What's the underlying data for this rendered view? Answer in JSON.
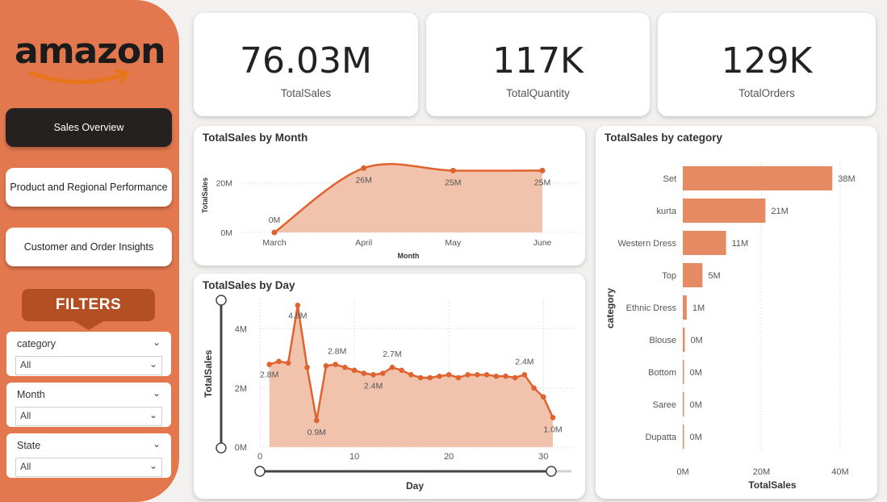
{
  "app": {
    "logo_text": "amazon"
  },
  "nav": [
    {
      "label": "Sales Overview",
      "active": true
    },
    {
      "label": "Product and Regional Performance",
      "active": false
    },
    {
      "label": "Customer and Order Insights",
      "active": false
    }
  ],
  "filters": {
    "title": "FILTERS",
    "items": [
      {
        "label": "category",
        "value": "All"
      },
      {
        "label": "Month",
        "value": "All"
      },
      {
        "label": "State",
        "value": "All"
      }
    ]
  },
  "kpis": [
    {
      "value": "76.03M",
      "label": "TotalSales"
    },
    {
      "value": "117K",
      "label": "TotalQuantity"
    },
    {
      "value": "129K",
      "label": "TotalOrders"
    }
  ],
  "colors": {
    "accent": "#e3784f",
    "series": "#e0622f",
    "area": "#f1c3ad",
    "bar": "#e58a62",
    "dark": "#252121",
    "badge": "#b34f22"
  },
  "chart_data": [
    {
      "type": "area",
      "title": "TotalSales by Month",
      "xlabel": "Month",
      "ylabel": "TotalSales",
      "categories": [
        "March",
        "April",
        "May",
        "June"
      ],
      "values": [
        0,
        26,
        25,
        25
      ],
      "data_labels": [
        "0M",
        "26M",
        "25M",
        "25M"
      ],
      "y_ticks": [
        "0M",
        "20M"
      ],
      "ylim": [
        0,
        30
      ]
    },
    {
      "type": "area",
      "title": "TotalSales by Day",
      "xlabel": "Day",
      "ylabel": "TotalSales",
      "x": [
        1,
        2,
        3,
        4,
        5,
        6,
        7,
        8,
        9,
        10,
        11,
        12,
        13,
        14,
        15,
        16,
        17,
        18,
        19,
        20,
        21,
        22,
        23,
        24,
        25,
        26,
        27,
        28,
        29,
        30,
        31
      ],
      "values": [
        2.8,
        2.9,
        2.85,
        4.8,
        2.7,
        0.9,
        2.75,
        2.8,
        2.7,
        2.6,
        2.5,
        2.45,
        2.5,
        2.7,
        2.6,
        2.45,
        2.35,
        2.35,
        2.4,
        2.45,
        2.35,
        2.45,
        2.45,
        2.45,
        2.4,
        2.4,
        2.35,
        2.45,
        2.0,
        1.7,
        1.0
      ],
      "data_labels": [
        {
          "x": 1,
          "text": "2.8M"
        },
        {
          "x": 4,
          "text": "4.8M"
        },
        {
          "x": 6,
          "text": "0.9M"
        },
        {
          "x": 8,
          "text": "2.8M"
        },
        {
          "x": 12,
          "text": "2.4M"
        },
        {
          "x": 14,
          "text": "2.7M"
        },
        {
          "x": 28,
          "text": "2.4M"
        },
        {
          "x": 31,
          "text": "1.0M"
        }
      ],
      "x_ticks": [
        0,
        10,
        20,
        30
      ],
      "y_ticks": [
        "0M",
        "2M",
        "4M"
      ],
      "xlim": [
        0,
        31
      ],
      "ylim": [
        0,
        5
      ]
    },
    {
      "type": "bar",
      "orientation": "horizontal",
      "title": "TotalSales by category",
      "xlabel": "TotalSales",
      "ylabel": "category",
      "categories": [
        "Set",
        "kurta",
        "Western Dress",
        "Top",
        "Ethnic Dress",
        "Blouse",
        "Bottom",
        "Saree",
        "Dupatta"
      ],
      "values": [
        38,
        21,
        11,
        5,
        1,
        0.5,
        0.2,
        0.1,
        0.1
      ],
      "data_labels": [
        "38M",
        "21M",
        "11M",
        "5M",
        "1M",
        "0M",
        "0M",
        "0M",
        "0M"
      ],
      "x_ticks": [
        "0M",
        "20M",
        "40M"
      ],
      "xlim": [
        0,
        40
      ]
    }
  ]
}
